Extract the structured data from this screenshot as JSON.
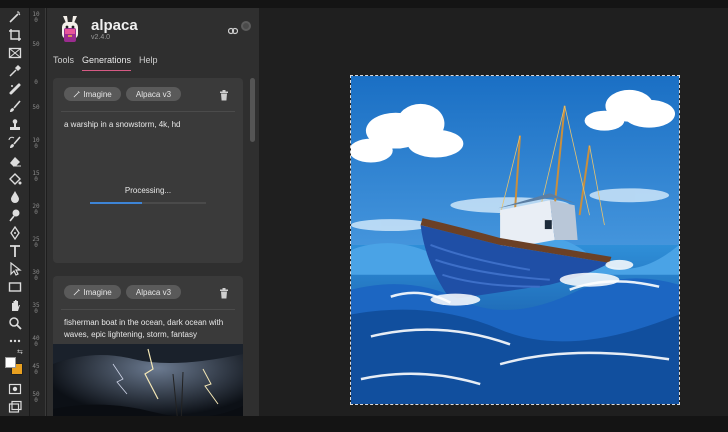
{
  "app": {
    "name": "alpaca",
    "version": "v2.4.0"
  },
  "tabs": [
    {
      "label": "Tools",
      "active": false
    },
    {
      "label": "Generations",
      "active": true
    },
    {
      "label": "Help",
      "active": false
    }
  ],
  "ruler_ticks": [
    "100",
    "50",
    "0",
    "50",
    "100",
    "150",
    "200",
    "250",
    "300",
    "350",
    "400",
    "450",
    "500"
  ],
  "generations": [
    {
      "mode_label": "Imagine",
      "model_label": "Alpaca v3",
      "prompt": "a warship in a snowstorm, 4k, hd",
      "status": "Processing...",
      "progress": 0.45
    },
    {
      "mode_label": "Imagine",
      "model_label": "Alpaca v3",
      "prompt": "fisherman boat in the ocean, dark ocean with waves, epic lightening, storm, fantasy"
    }
  ],
  "icons": {
    "tools": [
      "wand-icon",
      "crop-icon",
      "frame-icon",
      "eyedropper-icon",
      "healing-icon",
      "brush-icon",
      "stamp-icon",
      "history-brush-icon",
      "eraser-icon",
      "bucket-icon",
      "blur-icon",
      "dodge-icon",
      "pen-icon",
      "type-icon",
      "path-select-icon",
      "rectangle-icon",
      "hand-icon",
      "zoom-icon",
      "more-icon"
    ],
    "panel": [
      "alpaca-logo",
      "link-icon",
      "status-dot",
      "wand-small-icon",
      "trash-icon"
    ]
  },
  "colors": {
    "accent": "#d65a84",
    "progress": "#3d84d6",
    "foreground_swatch": "#ffffff",
    "background_swatch": "#e8a020"
  }
}
